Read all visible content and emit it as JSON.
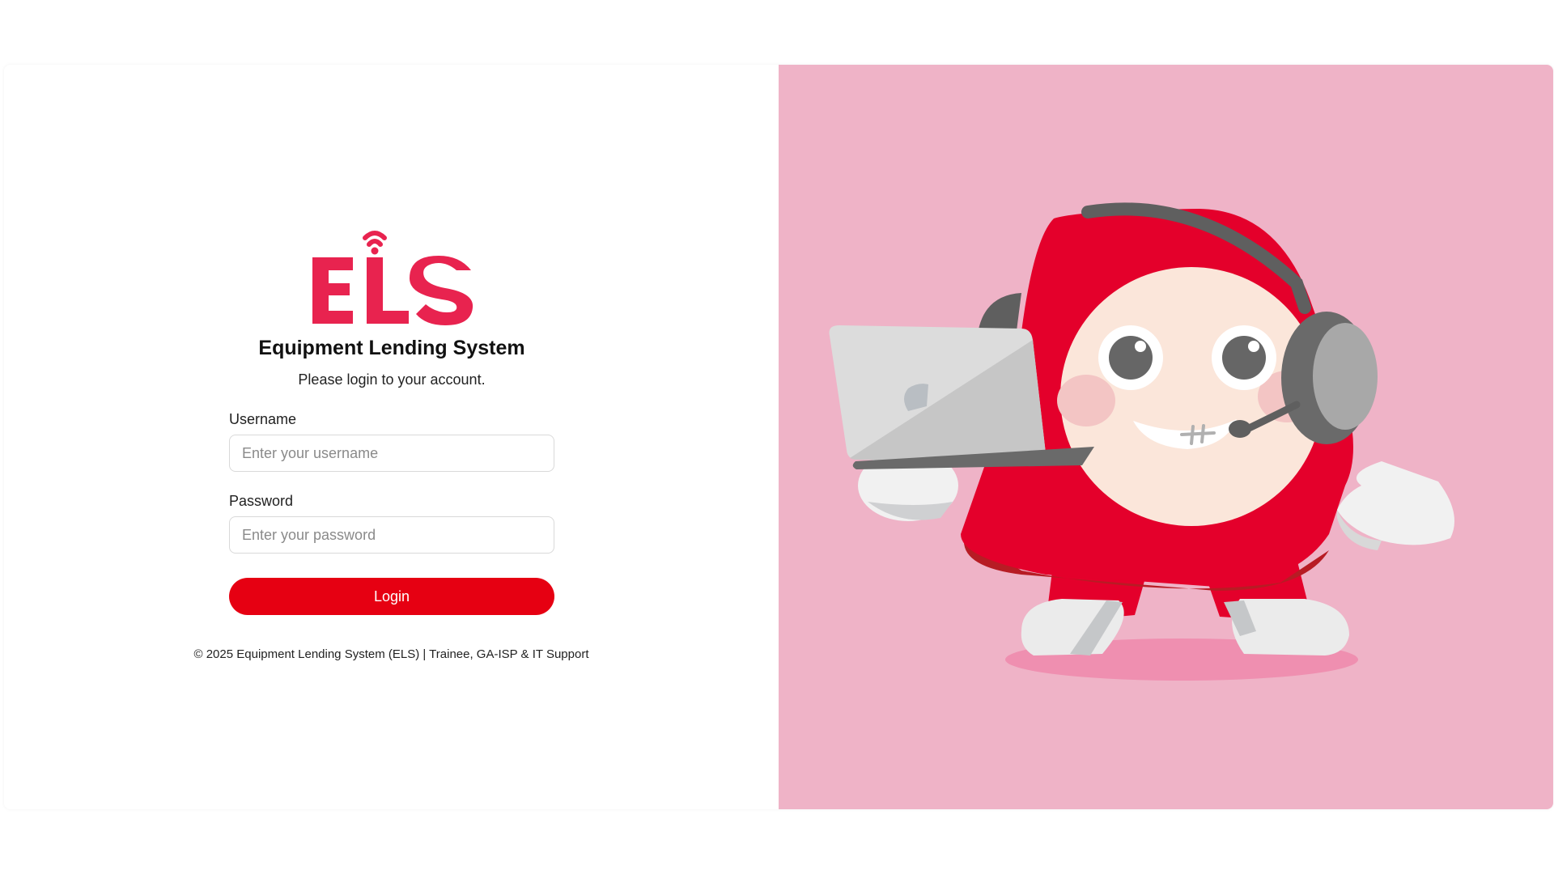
{
  "brand": {
    "logo_text": "ELS",
    "title": "Equipment Lending System",
    "subtitle": "Please login to your account.",
    "accent_color": "#e8234f",
    "button_color": "#e60012",
    "illustration_bg": "#efb3c7"
  },
  "form": {
    "username_label": "Username",
    "username_placeholder": "Enter your username",
    "password_label": "Password",
    "password_placeholder": "Enter your password",
    "login_label": "Login"
  },
  "footer": {
    "text": "© 2025 Equipment Lending System (ELS) | Trainee, GA-ISP & IT Support"
  },
  "illustration": {
    "icon": "mascot-with-headset-and-laptop-illustration"
  }
}
